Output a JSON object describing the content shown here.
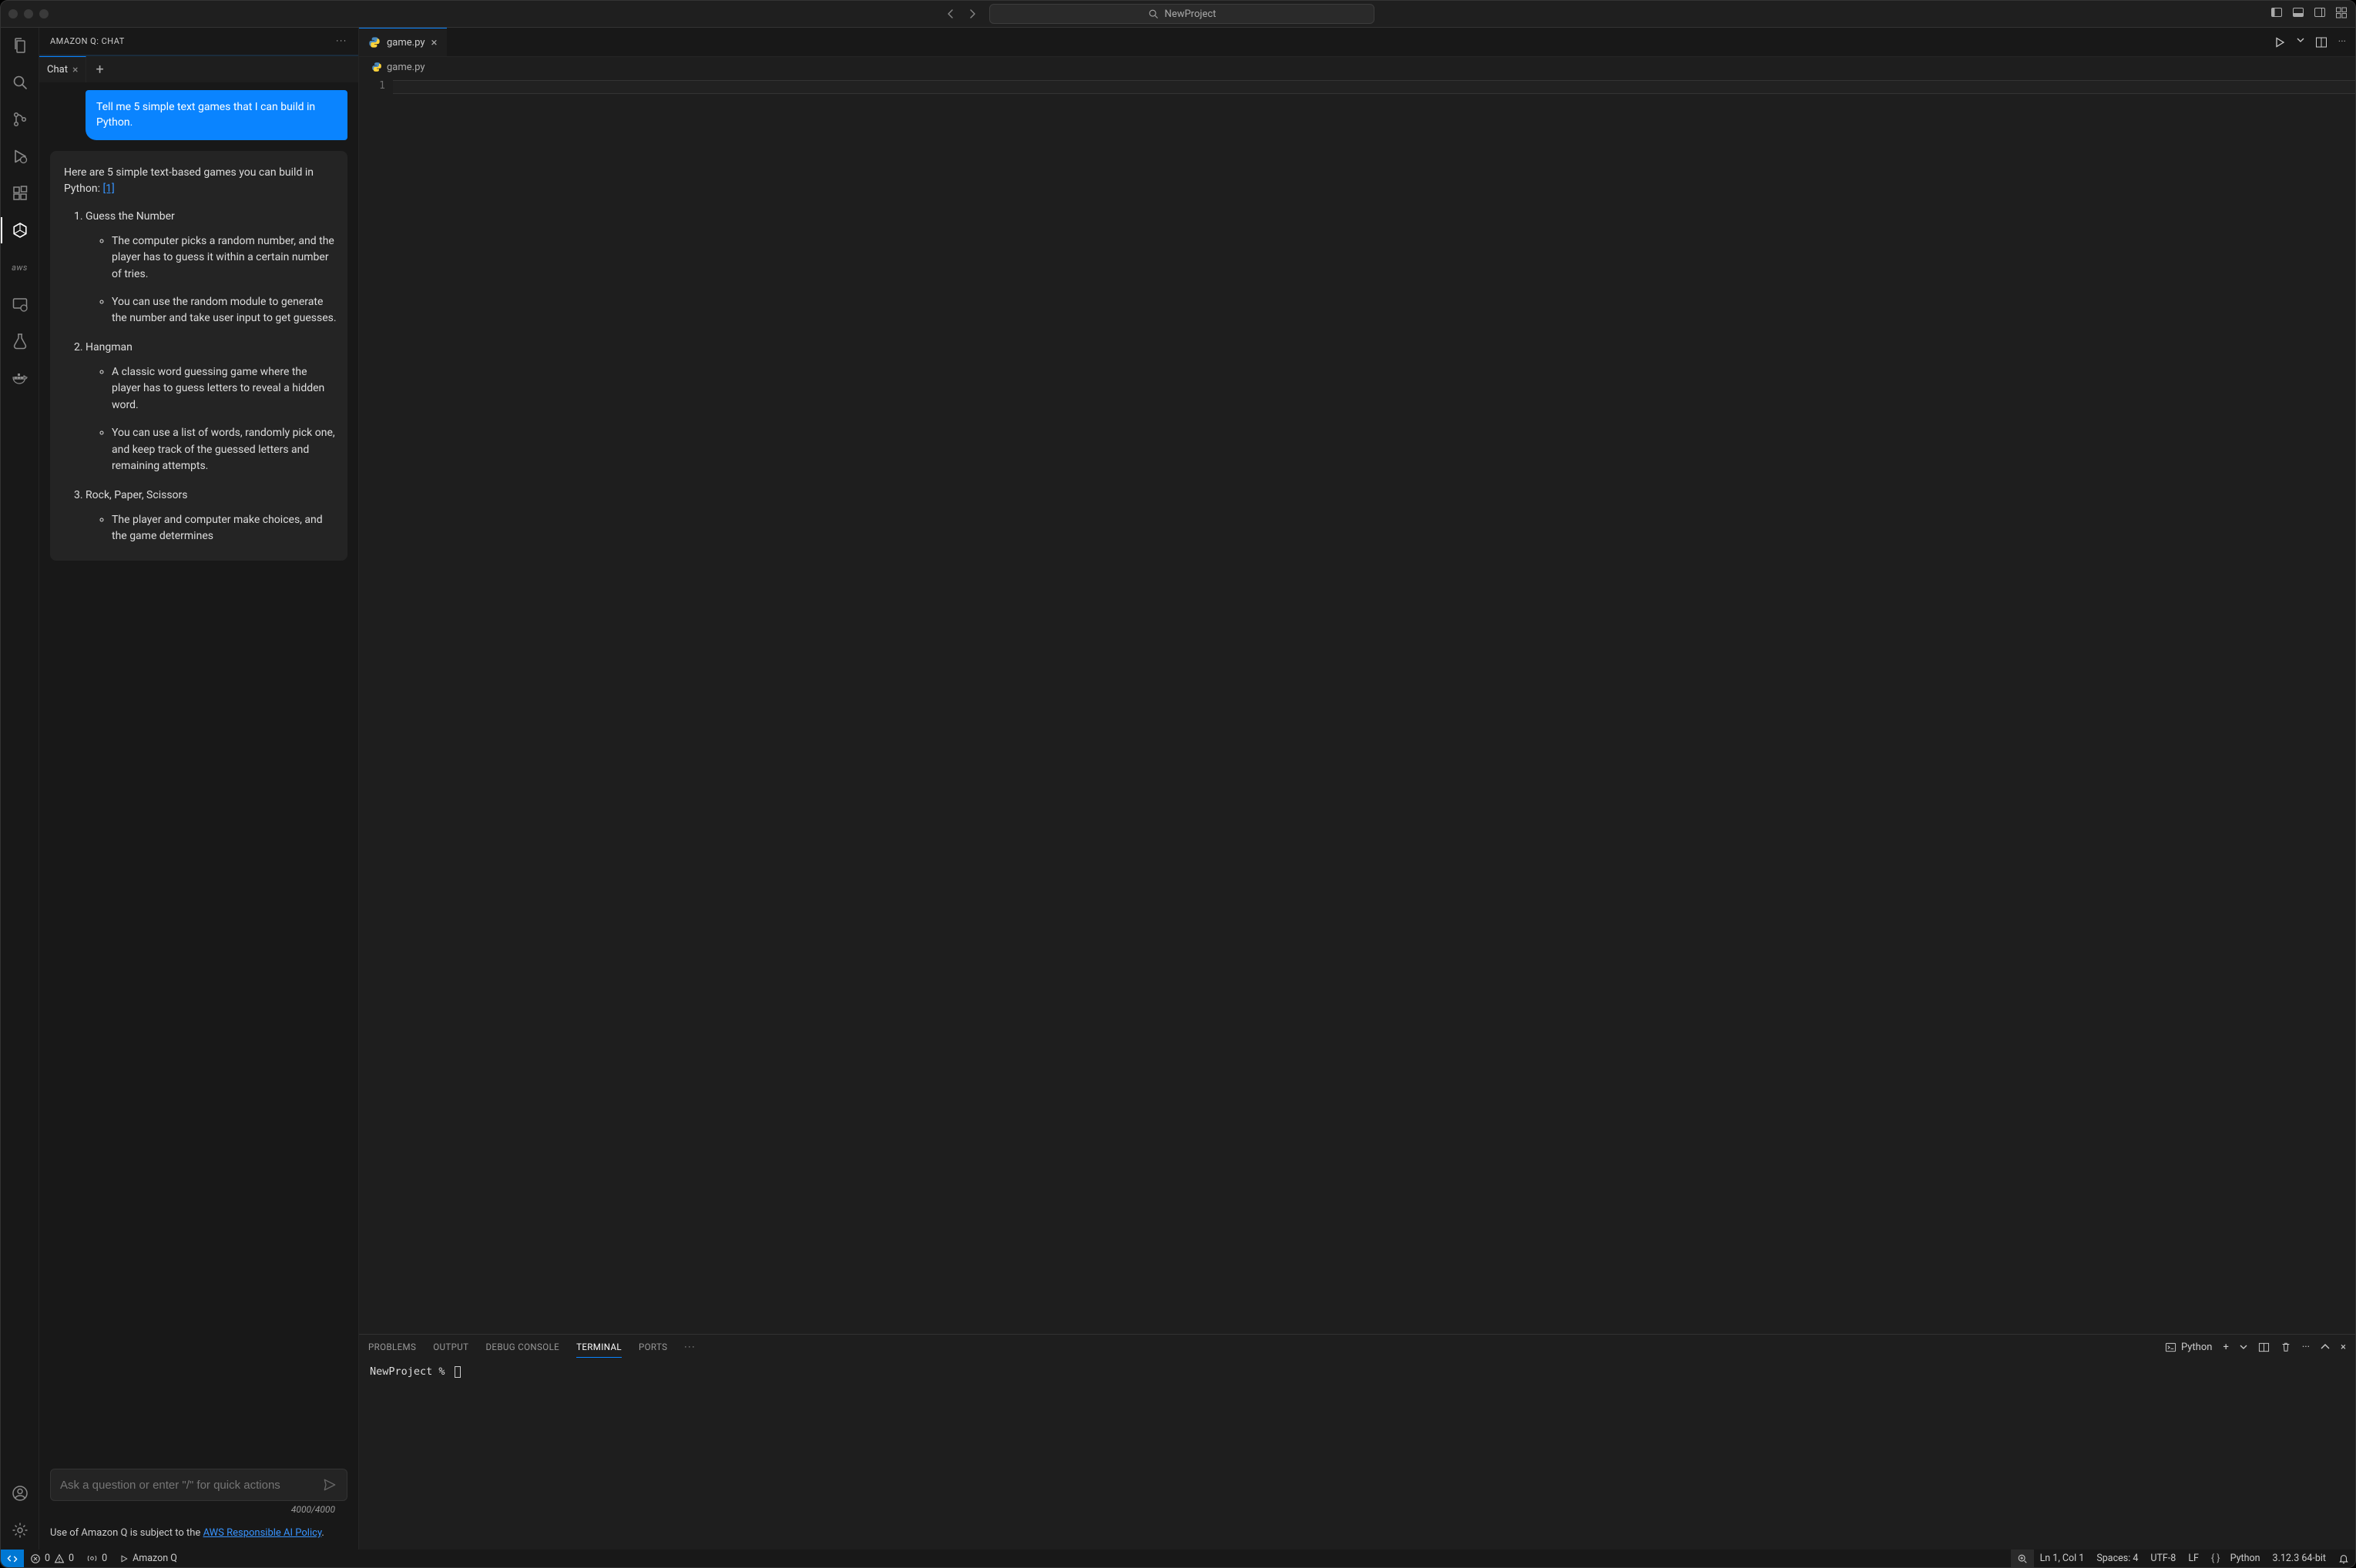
{
  "titlebar": {
    "project": "NewProject"
  },
  "activity": {
    "icons": [
      "files",
      "search",
      "git",
      "debug",
      "extensions",
      "amazon-q",
      "aws",
      "remote",
      "testing",
      "docker"
    ],
    "bottom": [
      "account",
      "settings"
    ]
  },
  "sidepanel": {
    "title": "AMAZON Q: CHAT",
    "tab_label": "Chat",
    "user_message": "Tell me 5 simple text games that I can build in Python.",
    "ai_intro_prefix": "Here are 5 simple text-based games you can build in Python: ",
    "ai_citation": "[1]",
    "games": [
      {
        "name": "Guess the Number",
        "bullets": [
          "The computer picks a random number, and the player has to guess it within a certain number of tries.",
          "You can use the random module to generate the number and take user input to get guesses."
        ]
      },
      {
        "name": "Hangman",
        "bullets": [
          "A classic word guessing game where the player has to guess letters to reveal a hidden word.",
          "You can use a list of words, randomly pick one, and keep track of the guessed letters and remaining attempts."
        ]
      },
      {
        "name": "Rock, Paper, Scissors",
        "bullets": [
          "The player and computer make choices, and the game determines"
        ]
      }
    ],
    "input_placeholder": "Ask a question or enter \"/\" for quick actions",
    "char_count": "4000/4000",
    "policy_prefix": "Use of Amazon Q is subject to the ",
    "policy_link": "AWS Responsible AI Policy",
    "policy_suffix": "."
  },
  "editor": {
    "tab_file": "game.py",
    "breadcrumb_file": "game.py",
    "line_number": "1"
  },
  "panel": {
    "tabs": [
      "PROBLEMS",
      "OUTPUT",
      "DEBUG CONSOLE",
      "TERMINAL",
      "PORTS"
    ],
    "active": "TERMINAL",
    "shell_label": "Python",
    "prompt": "NewProject % "
  },
  "status": {
    "errors": "0",
    "warnings": "0",
    "ports": "0",
    "amazonq": "Amazon Q",
    "ln_col": "Ln 1, Col 1",
    "spaces": "Spaces: 4",
    "encoding": "UTF-8",
    "eol": "LF",
    "lang": "Python",
    "interp": "3.12.3 64-bit"
  }
}
